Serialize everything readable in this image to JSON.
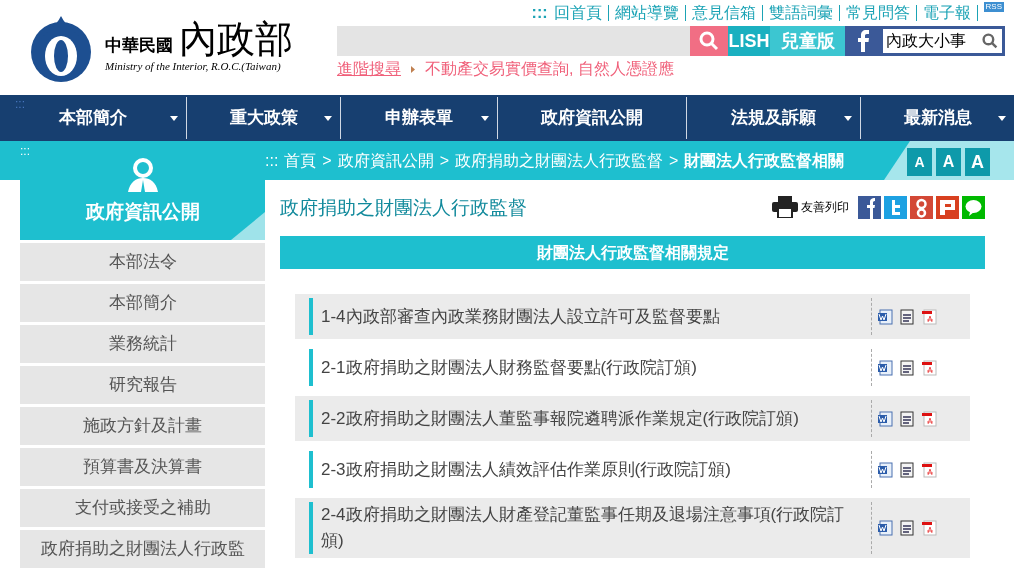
{
  "header": {
    "logo_small": "中華民國",
    "logo_big": "內政部",
    "logo_english": "Ministry of the Interior, R.O.C.(Taiwan)",
    "top_links": [
      ":::",
      "回首頁",
      "網站導覽",
      "意見信箱",
      "雙語詞彙",
      "常見問答",
      "電子報"
    ],
    "rss": "RSS",
    "english_button": "LISH",
    "kids_button": "兒童版",
    "site_search": {
      "value": "內政大小事"
    },
    "advanced_search": "進階搜尋",
    "marquee": "不動產交易實價查詢, 自然人憑證應"
  },
  "nav": {
    "marker": ":::",
    "items": [
      {
        "label": "本部簡介",
        "dropdown": true
      },
      {
        "label": "重大政策",
        "dropdown": true
      },
      {
        "label": "申辦表單",
        "dropdown": true
      },
      {
        "label": "政府資訊公開",
        "dropdown": false
      },
      {
        "label": "法規及訴願",
        "dropdown": true
      },
      {
        "label": "最新消息",
        "dropdown": true
      }
    ]
  },
  "breadcrumb": {
    "marker": ":::",
    "items": [
      "首頁",
      "政府資訊公開",
      "政府捐助之財團法人行政監督",
      "財團法人行政監督相關"
    ],
    "separator": ">"
  },
  "font_sizes": [
    "A",
    "A",
    "A"
  ],
  "sidebar": {
    "marker": ":::",
    "title": "政府資訊公開",
    "items": [
      "本部法令",
      "本部簡介",
      "業務統計",
      "研究報告",
      "施政方針及計畫",
      "預算書及決算書",
      "支付或接受之補助",
      "政府捐助之財團法人行政監"
    ]
  },
  "page": {
    "title": "政府捐助之財團法人行政監督",
    "print": "友善列印",
    "section": "財團法人行政監督相關規定",
    "documents": [
      {
        "title": "1-4內政部審查內政業務財團法人設立許可及監督要點"
      },
      {
        "title": "2-1政府捐助之財團法人財務監督要點(行政院訂頒)"
      },
      {
        "title": "2-2政府捐助之財團法人董監事報院遴聘派作業規定(行政院訂頒)"
      },
      {
        "title": "2-3政府捐助之財團法人績效評估作業原則(行政院訂頒)"
      },
      {
        "title": "2-4政府捐助之財團法人財產登記董監事任期及退場注意事項(行政院訂頒)"
      }
    ]
  }
}
